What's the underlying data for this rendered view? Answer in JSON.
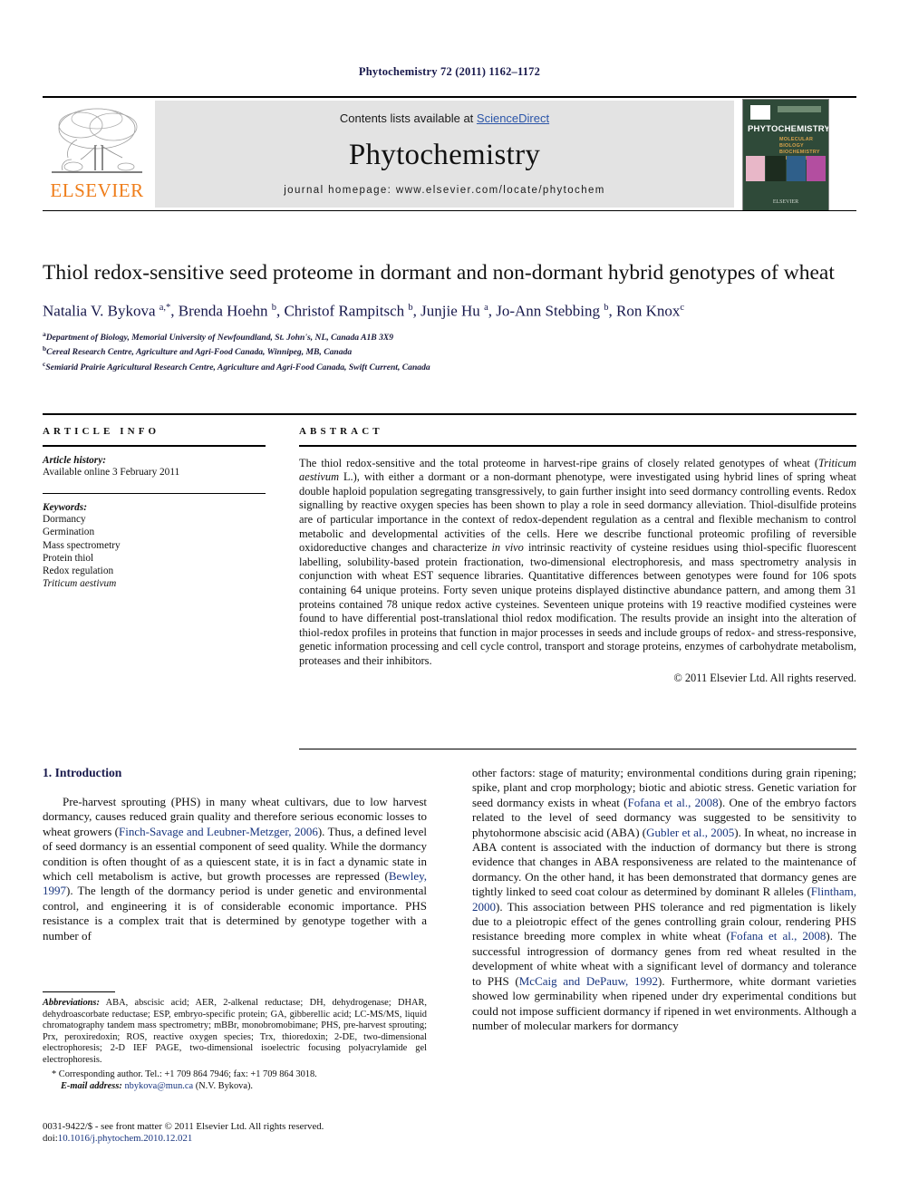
{
  "running_head": "Phytochemistry 72 (2011) 1162–1172",
  "masthead": {
    "contents_prefix": "Contents lists available at ",
    "sciencedirect": "ScienceDirect",
    "journal_name": "Phytochemistry",
    "homepage": "journal homepage: www.elsevier.com/locate/phytochem",
    "elsevier_wordmark": "ELSEVIER",
    "elsevier_orange": "#ef7d1a",
    "link_blue": "#2b55a8",
    "cover": {
      "title": "PHYTOCHEMISTRY",
      "subtitle": "MOLECULAR BIOLOGY\nBIOCHEMISTRY\nCHEMISTRY",
      "publisher": "ELSEVIER",
      "background": "#2f4a39"
    }
  },
  "article": {
    "title": "Thiol redox-sensitive seed proteome in dormant and non-dormant hybrid genotypes of wheat",
    "authors_html": "Natalia V. Bykova <sup>a,*</sup>, Brenda Hoehn <sup>b</sup>, Christof Rampitsch <sup>b</sup>, Junjie Hu <sup>a</sup>, Jo-Ann Stebbing <sup>b</sup>, Ron Knox<sup>c</sup>",
    "affiliations": [
      {
        "mark": "a",
        "text": "Department of Biology, Memorial University of Newfoundland, St. John's, NL, Canada A1B 3X9"
      },
      {
        "mark": "b",
        "text": "Cereal Research Centre, Agriculture and Agri-Food Canada, Winnipeg, MB, Canada"
      },
      {
        "mark": "c",
        "text": "Semiarid Prairie Agricultural Research Centre, Agriculture and Agri-Food Canada, Swift Current, Canada"
      }
    ]
  },
  "article_info": {
    "heading": "ARTICLE INFO",
    "history_label": "Article history:",
    "history_value": "Available online 3 February 2011",
    "keywords_label": "Keywords:",
    "keywords": [
      "Dormancy",
      "Germination",
      "Mass spectrometry",
      "Protein thiol",
      "Redox regulation",
      "Triticum aestivum"
    ]
  },
  "abstract": {
    "heading": "ABSTRACT",
    "text_html": "The thiol redox-sensitive and the total proteome in harvest-ripe grains of closely related genotypes of wheat (<i>Triticum aestivum</i> L.), with either a dormant or a non-dormant phenotype, were investigated using hybrid lines of spring wheat double haploid population segregating transgressively, to gain further insight into seed dormancy controlling events. Redox signalling by reactive oxygen species has been shown to play a role in seed dormancy alleviation. Thiol-disulfide proteins are of particular importance in the context of redox-dependent regulation as a central and flexible mechanism to control metabolic and developmental activities of the cells. Here we describe functional proteomic profiling of reversible oxidoreductive changes and characterize <i>in vivo</i> intrinsic reactivity of cysteine residues using thiol-specific fluorescent labelling, solubility-based protein fractionation, two-dimensional electrophoresis, and mass spectrometry analysis in conjunction with wheat EST sequence libraries. Quantitative differences between genotypes were found for 106 spots containing 64 unique proteins. Forty seven unique proteins displayed distinctive abundance pattern, and among them 31 proteins contained 78 unique redox active cysteines. Seventeen unique proteins with 19 reactive modified cysteines were found to have differential post-translational thiol redox modification. The results provide an insight into the alteration of thiol-redox profiles in proteins that function in major processes in seeds and include groups of redox- and stress-responsive, genetic information processing and cell cycle control, transport and storage proteins, enzymes of carbohydrate metabolism, proteases and their inhibitors.",
    "copyright": "© 2011 Elsevier Ltd. All rights reserved."
  },
  "body": {
    "section_heading": "1. Introduction",
    "left_paragraph_html": "Pre-harvest sprouting (PHS) in many wheat cultivars, due to low harvest dormancy, causes reduced grain quality and therefore serious economic losses to wheat growers (<span class=\"ref\">Finch-Savage and Leubner-Metzger, 2006</span>). Thus, a defined level of seed dormancy is an essential component of seed quality. While the dormancy condition is often thought of as a quiescent state, it is in fact a dynamic state in which cell metabolism is active, but growth processes are repressed (<span class=\"ref\">Bewley, 1997</span>). The length of the dormancy period is under genetic and environmental control, and engineering it is of considerable economic importance. PHS resistance is a complex trait that is determined by genotype together with a number of",
    "right_paragraph_html": "other factors: stage of maturity; environmental conditions during grain ripening; spike, plant and crop morphology; biotic and abiotic stress. Genetic variation for seed dormancy exists in wheat (<span class=\"ref\">Fofana et al., 2008</span>). One of the embryo factors related to the level of seed dormancy was suggested to be sensitivity to phytohormone abscisic acid (ABA) (<span class=\"ref\">Gubler et al., 2005</span>). In wheat, no increase in ABA content is associated with the induction of dormancy but there is strong evidence that changes in ABA responsiveness are related to the maintenance of dormancy. On the other hand, it has been demonstrated that dormancy genes are tightly linked to seed coat colour as determined by dominant R alleles (<span class=\"ref\">Flintham, 2000</span>). This association between PHS tolerance and red pigmentation is likely due to a pleiotropic effect of the genes controlling grain colour, rendering PHS resistance breeding more complex in white wheat (<span class=\"ref\">Fofana et al., 2008</span>). The successful introgression of dormancy genes from red wheat resulted in the development of white wheat with a significant level of dormancy and tolerance to PHS (<span class=\"ref\">McCaig and DePauw, 1992</span>). Furthermore, white dormant varieties showed low germinability when ripened under dry experimental conditions but could not impose sufficient dormancy if ripened in wet environments. Although a number of molecular markers for dormancy"
  },
  "footnotes": {
    "abbreviations_label": "Abbreviations:",
    "abbreviations_text": " ABA, abscisic acid; AER, 2-alkenal reductase; DH, dehydrogenase; DHAR, dehydroascorbate reductase; ESP, embryo-specific protein; GA, gibberellic acid; LC-MS/MS, liquid chromatography tandem mass spectrometry; mBBr, monobromobimane; PHS, pre-harvest sprouting; Prx, peroxiredoxin; ROS, reactive oxygen species; Trx, thioredoxin; 2-DE, two-dimensional electrophoresis; 2-D IEF PAGE, two-dimensional isoelectric focusing polyacrylamide gel electrophoresis.",
    "corresponding": "* Corresponding author. Tel.: +1 709 864 7946; fax: +1 709 864 3018.",
    "email_label": "E-mail address:",
    "email_address": "nbykova@mun.ca",
    "email_owner": "(N.V. Bykova)."
  },
  "imprint": {
    "line1": "0031-9422/$ - see front matter © 2011 Elsevier Ltd. All rights reserved.",
    "doi_label": "doi:",
    "doi_value": "10.1016/j.phytochem.2010.12.021"
  }
}
